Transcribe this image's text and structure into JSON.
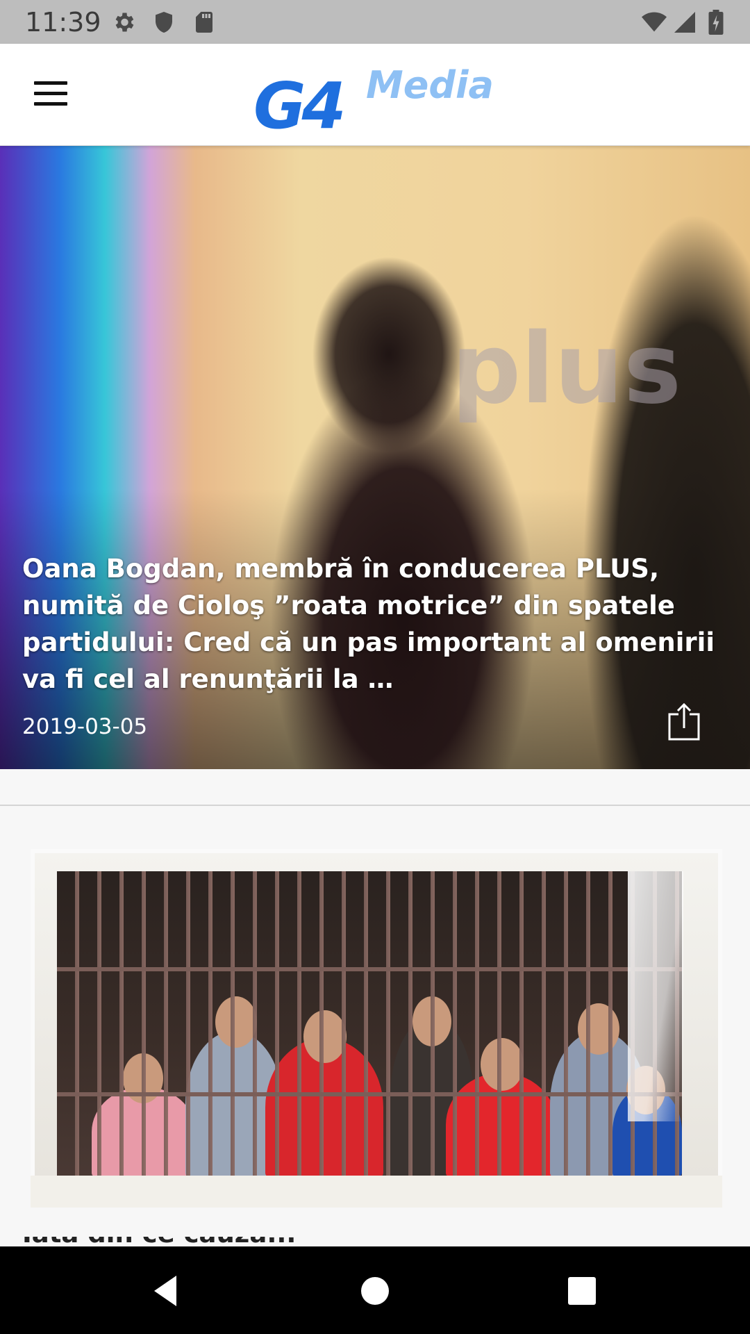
{
  "status_bar": {
    "time": "11:39",
    "icons": [
      "gear-icon",
      "shield-icon",
      "sd-card-icon",
      "wifi-icon",
      "signal-icon",
      "battery-icon"
    ]
  },
  "app_bar": {
    "menu_icon": "hamburger-menu-icon",
    "logo_main": "G4",
    "logo_sub": "Media",
    "colors": {
      "logo_main": "#1f6fde",
      "logo_sub": "#8ec0f4"
    }
  },
  "featured_article": {
    "title": "Oana Bogdan, membră în conducerea PLUS, numită de Cioloş ”roata motrice” din spatele partidului: Cred că un pas important al omenirii va fi cel al renunţării la …",
    "date": "2019-03-05",
    "image_text": "plus",
    "share_icon": "share-icon"
  },
  "second_article": {
    "title_peek": "Iată din ce cauză..."
  },
  "nav_bar": {
    "buttons": [
      "back-icon",
      "home-icon",
      "recents-icon"
    ]
  }
}
